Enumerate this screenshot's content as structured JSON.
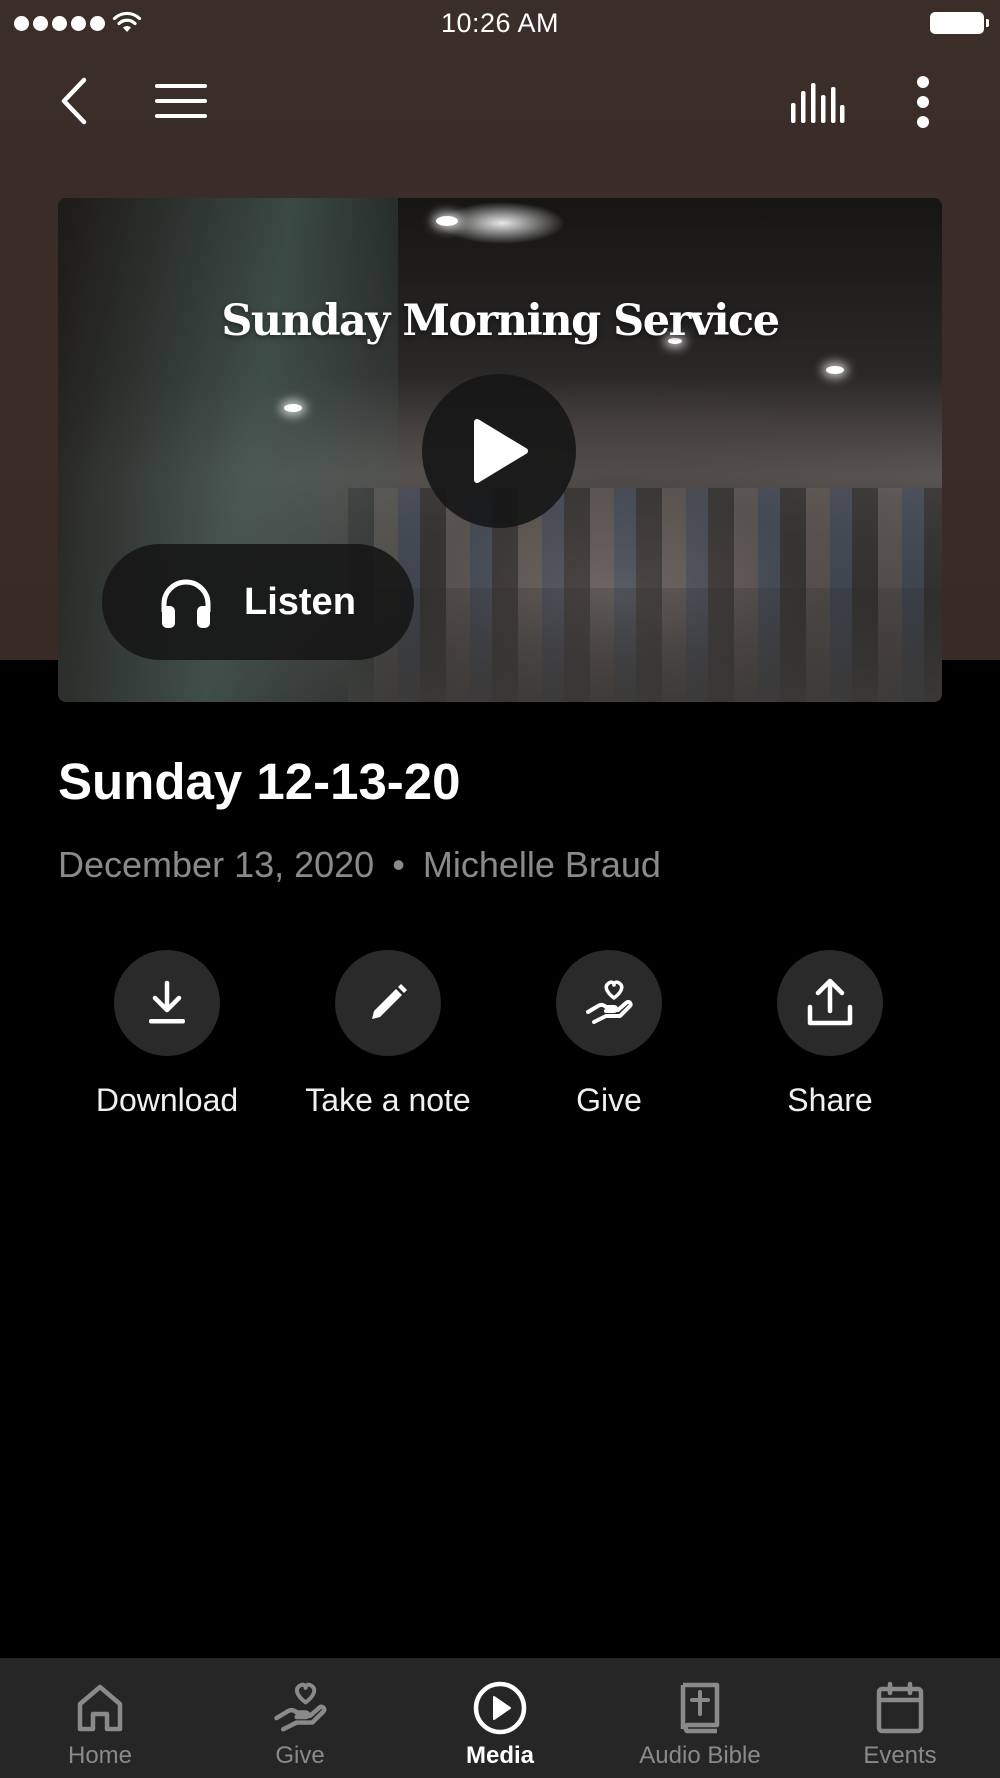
{
  "status_bar": {
    "time": "10:26 AM"
  },
  "top_bar": {
    "back_icon": "chevron-left-icon",
    "menu_icon": "hamburger-menu-icon",
    "audio_icon": "equalizer-bars-icon",
    "more_icon": "more-vertical-icon"
  },
  "hero": {
    "title": "Sunday Morning Service",
    "play_icon": "play-icon",
    "listen_label": "Listen",
    "listen_icon": "headphones-icon"
  },
  "episode": {
    "title": "Sunday 12-13-20",
    "date": "December 13, 2020",
    "separator": "•",
    "speaker": "Michelle Braud"
  },
  "actions": [
    {
      "label": "Download",
      "icon": "download-icon"
    },
    {
      "label": "Take a note",
      "icon": "pencil-icon"
    },
    {
      "label": "Give",
      "icon": "give-hand-heart-icon"
    },
    {
      "label": "Share",
      "icon": "share-upload-icon"
    }
  ],
  "tabs": [
    {
      "label": "Home",
      "icon": "home-icon",
      "active": false
    },
    {
      "label": "Give",
      "icon": "give-hand-heart-icon",
      "active": false
    },
    {
      "label": "Media",
      "icon": "play-circle-icon",
      "active": true
    },
    {
      "label": "Audio Bible",
      "icon": "bible-icon",
      "active": false
    },
    {
      "label": "Events",
      "icon": "calendar-icon",
      "active": false
    }
  ],
  "colors": {
    "header_background": "#3a2c27",
    "page_background": "#000000",
    "tab_bar_background": "#262626",
    "action_circle": "#2a2a2a",
    "muted_text": "#8a8a8a"
  }
}
